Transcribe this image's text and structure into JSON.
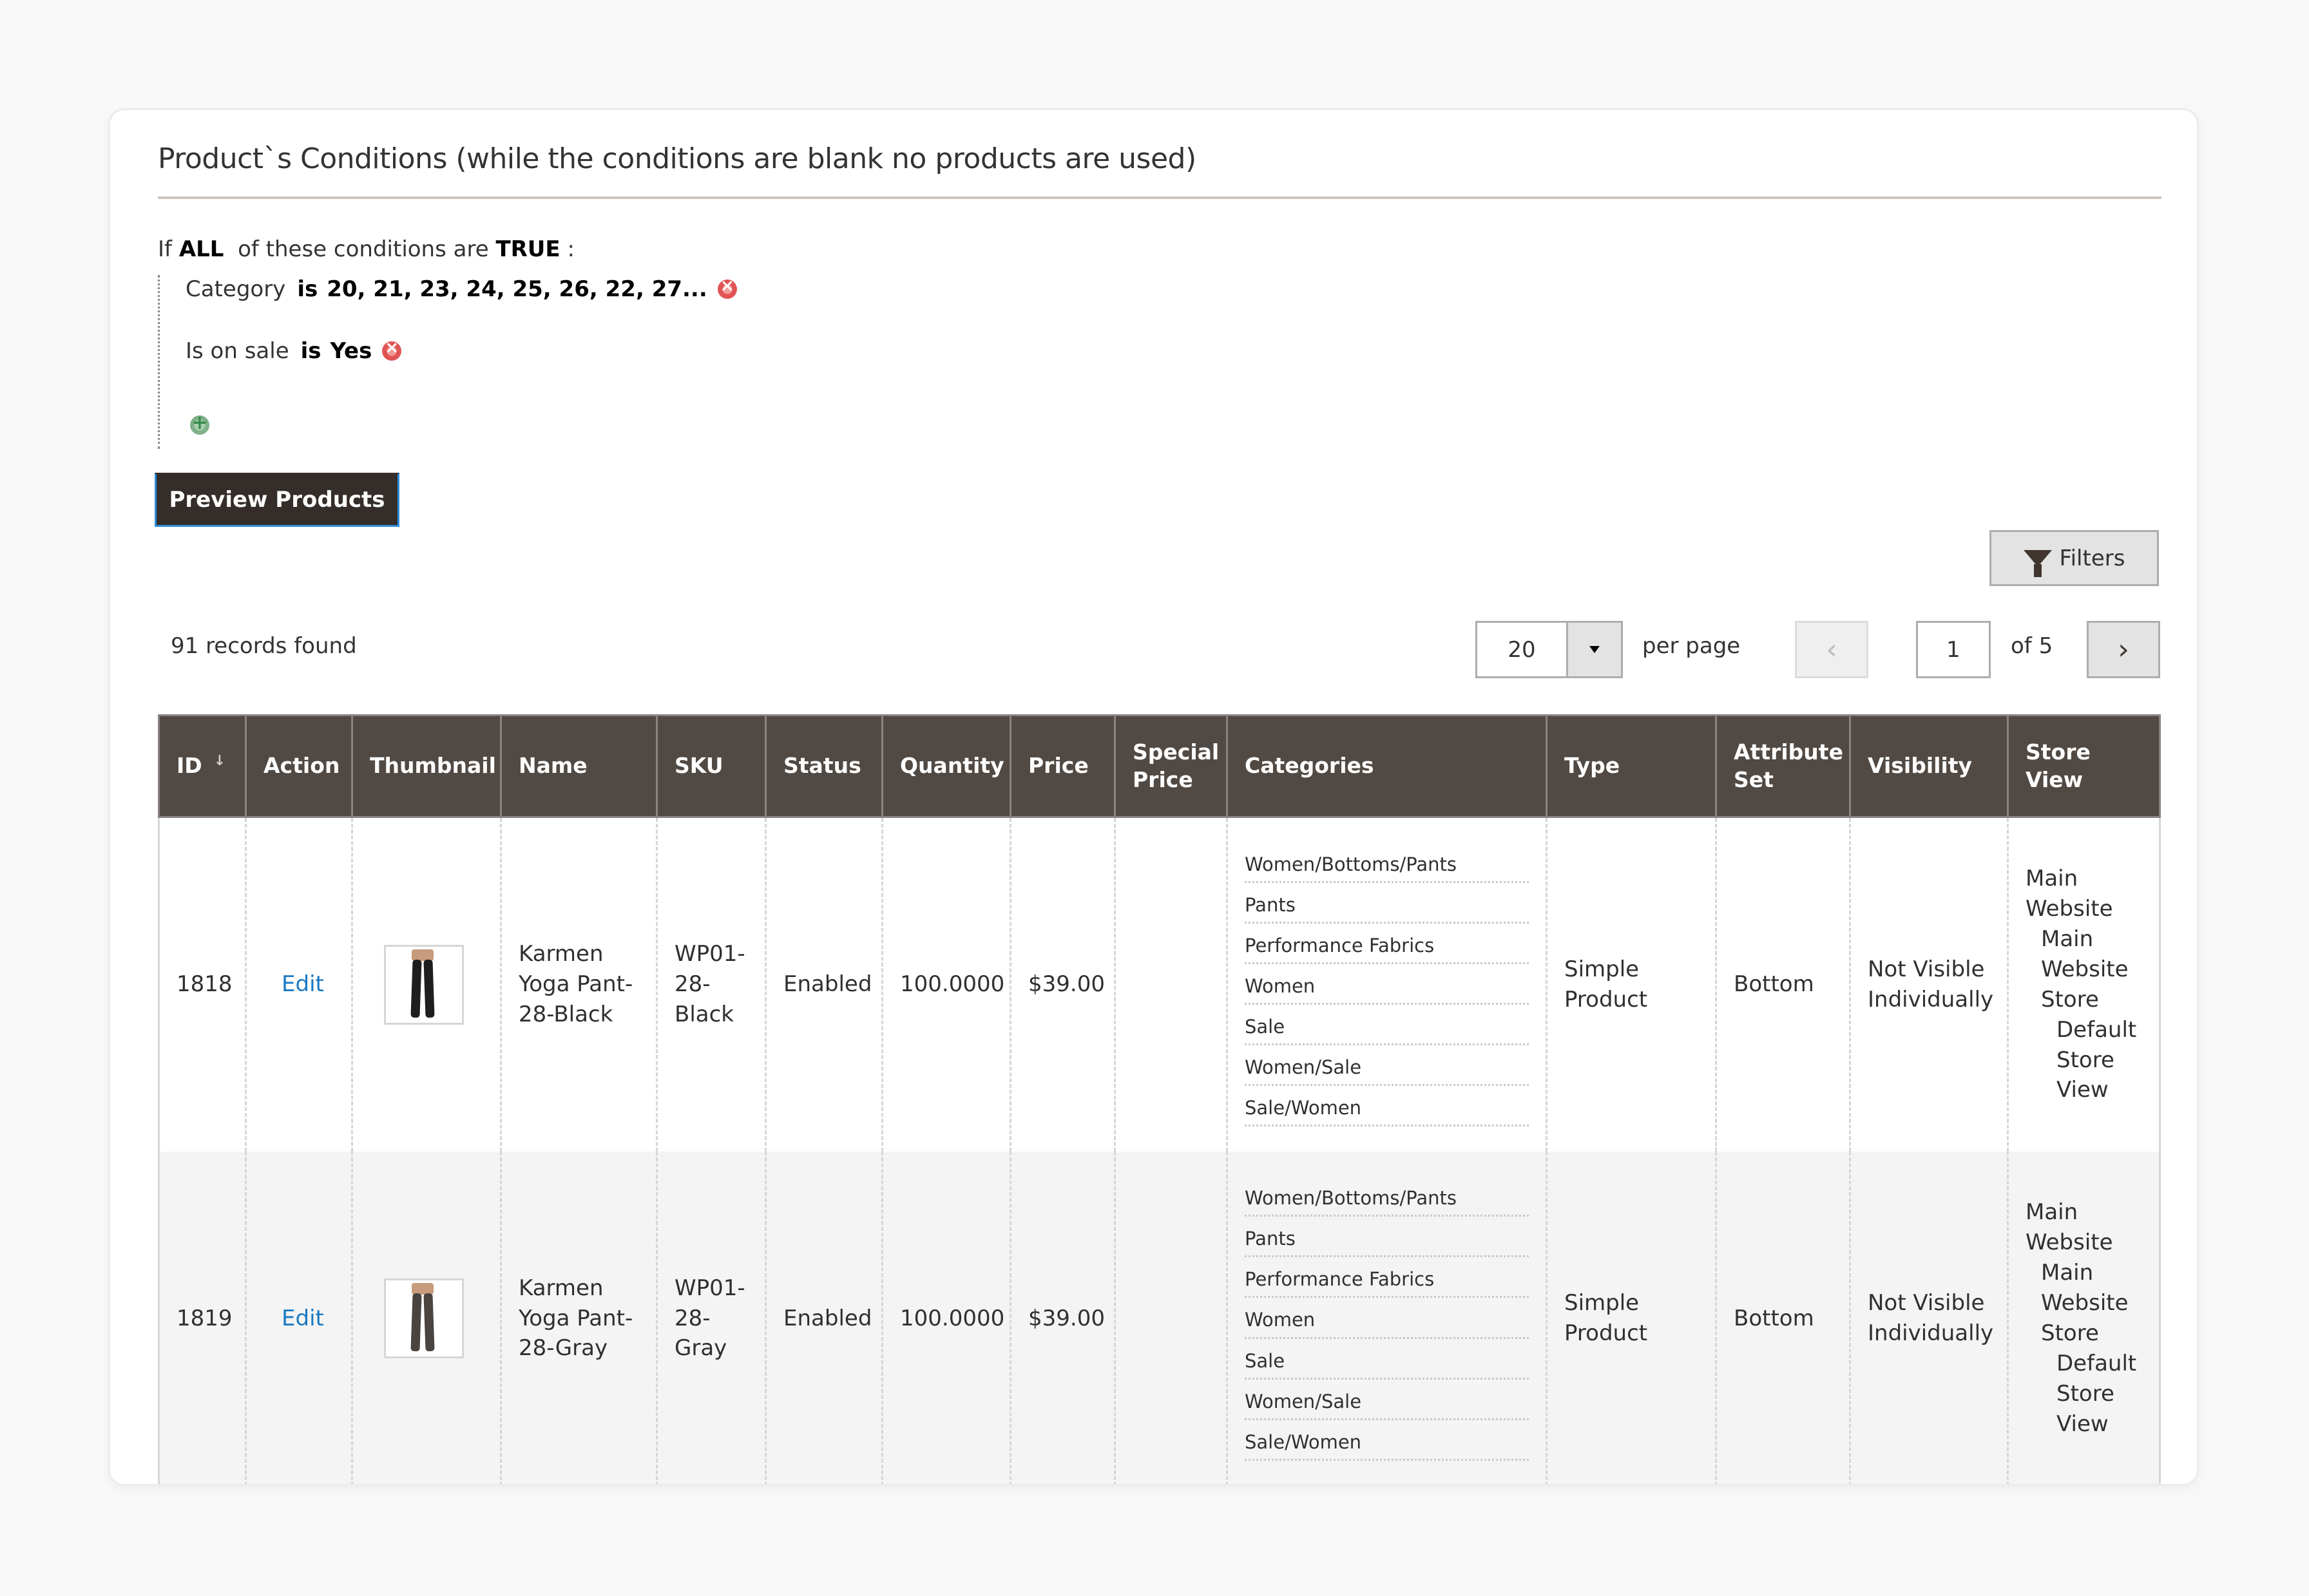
{
  "section": {
    "title": "Product`s Conditions (while the conditions are blank no products are used)"
  },
  "conditions": {
    "prefix": "If",
    "aggregator": "ALL",
    "middle": "of these conditions are",
    "value": "TRUE",
    "suffix": ":",
    "rules": [
      {
        "attribute": "Category",
        "operator": "is",
        "value": "20, 21, 23, 24, 25, 26, 22, 27..."
      },
      {
        "attribute": "Is on sale",
        "operator": "is",
        "value": "Yes"
      }
    ],
    "remove_icon": "remove-circle-icon",
    "add_icon": "add-circle-icon"
  },
  "preview_button": "Preview Products",
  "toolbar": {
    "filters_label": "Filters",
    "filters_icon": "funnel-icon",
    "records_found": "91 records found",
    "per_page_value": "20",
    "per_page_label": "per page",
    "prev_glyph": "‹",
    "next_glyph": "›",
    "current_page": "1",
    "page_total": "of 5"
  },
  "table": {
    "columns": [
      "ID",
      "Action",
      "Thumbnail",
      "Name",
      "SKU",
      "Status",
      "Quantity",
      "Price",
      "Special Price",
      "Categories",
      "Type",
      "Attribute Set",
      "Visibility",
      "Store View"
    ],
    "sort_indicator": "↓",
    "rows": [
      {
        "id": "1818",
        "action": "Edit",
        "thumbnail_color": "#1e1e1e",
        "name": "Karmen Yoga Pant-28-Black",
        "sku": "WP01-28-Black",
        "status": "Enabled",
        "quantity": "100.0000",
        "price": "$39.00",
        "special_price": "",
        "categories": [
          "Women/Bottoms/Pants",
          "Pants",
          "Performance Fabrics",
          "Women",
          "Sale",
          "Women/Sale",
          "Sale/Women"
        ],
        "type": "Simple Product",
        "attribute_set": "Bottom",
        "visibility": "Not Visible Individually",
        "store_view": [
          "Main Website",
          "Main Website Store",
          "Default Store View"
        ]
      },
      {
        "id": "1819",
        "action": "Edit",
        "thumbnail_color": "#4a4440",
        "name": "Karmen Yoga Pant-28-Gray",
        "sku": "WP01-28-Gray",
        "status": "Enabled",
        "quantity": "100.0000",
        "price": "$39.00",
        "special_price": "",
        "categories": [
          "Women/Bottoms/Pants",
          "Pants",
          "Performance Fabrics",
          "Women",
          "Sale",
          "Women/Sale",
          "Sale/Women"
        ],
        "type": "Simple Product",
        "attribute_set": "Bottom",
        "visibility": "Not Visible Individually",
        "store_view": [
          "Main Website",
          "Main Website Store",
          "Default Store View"
        ]
      }
    ]
  },
  "colors": {
    "header_bg": "#514943",
    "button_dark": "#342d2a",
    "link": "#1979c3",
    "focus_border": "#2e8ddb"
  }
}
